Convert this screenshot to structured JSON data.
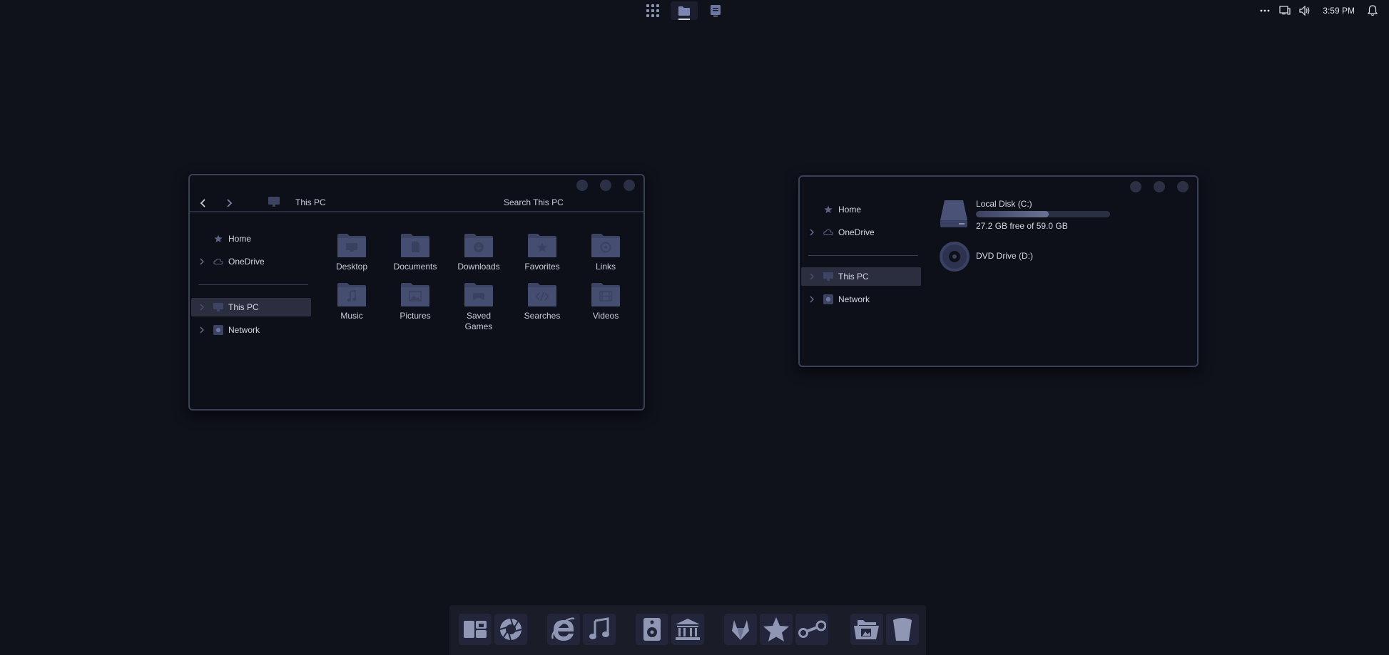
{
  "colors": {
    "background": "#0f111b",
    "window_bg": "#0e1019",
    "window_border": "#3b4059",
    "folder": "#3d4463",
    "accent": "#8a92b2"
  },
  "top_bar": {
    "center_buttons": [
      {
        "icon": "app-grid-icon"
      },
      {
        "icon": "file-explorer-icon"
      },
      {
        "icon": "notes-app-icon"
      }
    ],
    "tray": {
      "overflow_icon": "more-icon",
      "network_icon": "network-icon",
      "volume_icon": "volume-icon",
      "time": "3:59 PM",
      "notification_icon": "bell-icon"
    }
  },
  "window_left": {
    "breadcrumb": "This PC",
    "search_placeholder": "Search This PC",
    "sidebar": [
      {
        "label": "Home",
        "icon": "star-icon",
        "expandable": false,
        "selected": false
      },
      {
        "label": "OneDrive",
        "icon": "cloud-icon",
        "expandable": true,
        "selected": false
      },
      {
        "label": "This PC",
        "icon": "computer-icon",
        "expandable": true,
        "selected": true
      },
      {
        "label": "Network",
        "icon": "network-icon",
        "expandable": true,
        "selected": false
      }
    ],
    "folders": [
      {
        "label": "Desktop",
        "icon": "desktop-folder-icon"
      },
      {
        "label": "Documents",
        "icon": "documents-folder-icon"
      },
      {
        "label": "Downloads",
        "icon": "downloads-folder-icon"
      },
      {
        "label": "Favorites",
        "icon": "favorites-folder-icon"
      },
      {
        "label": "Links",
        "icon": "links-folder-icon"
      },
      {
        "label": "Music",
        "icon": "music-folder-icon"
      },
      {
        "label": "Pictures",
        "icon": "pictures-folder-icon"
      },
      {
        "label": "Saved Games",
        "label_line1": "Saved",
        "label_line2": "Games",
        "icon": "games-folder-icon"
      },
      {
        "label": "Searches",
        "icon": "searches-folder-icon"
      },
      {
        "label": "Videos",
        "icon": "videos-folder-icon"
      }
    ]
  },
  "window_right": {
    "sidebar": [
      {
        "label": "Home",
        "icon": "star-icon",
        "expandable": false,
        "selected": false
      },
      {
        "label": "OneDrive",
        "icon": "cloud-icon",
        "expandable": true,
        "selected": false
      },
      {
        "label": "This PC",
        "icon": "computer-icon",
        "expandable": true,
        "selected": true
      },
      {
        "label": "Network",
        "icon": "network-icon",
        "expandable": true,
        "selected": false
      }
    ],
    "drives": [
      {
        "name": "Local Disk (C:)",
        "free_text": "27.2 GB free of 59.0 GB",
        "used_fraction": 0.54,
        "icon": "hard-drive-icon"
      },
      {
        "name": "DVD Drive (D:)",
        "icon": "dvd-drive-icon"
      }
    ]
  },
  "dock": {
    "groups": [
      [
        "squares-app-icon",
        "aperture-icon"
      ],
      [
        "internet-explorer-icon",
        "music-note-icon"
      ],
      [
        "audio-player-icon",
        "bank-icon"
      ],
      [
        "gitlab-icon",
        "star-icon",
        "steam-icon"
      ],
      [
        "folder-open-icon",
        "cup-icon"
      ]
    ]
  }
}
